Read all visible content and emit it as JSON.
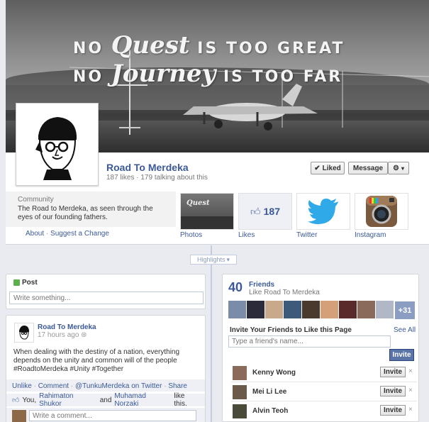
{
  "cover": {
    "line1_a": "NO",
    "line1_script": "Quest",
    "line1_b": "IS TOO GREAT",
    "line2_a": "NO",
    "line2_script": "Journey",
    "line2_b": "IS TOO FAR"
  },
  "page": {
    "name": "Road To Merdeka",
    "stats": "187 likes · 179 talking about this",
    "liked_label": "Liked",
    "message_label": "Message"
  },
  "about": {
    "category": "Community",
    "description": "The Road to Merdeka, as seen through the eyes of our founding fathers.",
    "about_link": "About",
    "separator": "·",
    "suggest_link": "Suggest a Change"
  },
  "apps": {
    "photos": "Photos",
    "likes": "Likes",
    "likes_count": "187",
    "twitter": "Twitter",
    "instagram": "Instagram",
    "photos_thumb_text": "Quest"
  },
  "highlights_label": "Highlights",
  "composer": {
    "label": "Post",
    "placeholder": "Write something..."
  },
  "post": {
    "author": "Road To Merdeka",
    "time": "17 hours ago",
    "text": "When dealing with the destiny of a nation, everything depends on the unity and common will of the people #RoadtoMerdeka #Unity #Together",
    "unlike": "Unlike",
    "comment": "Comment",
    "twitter": "@TunkuMerdeka on Twitter",
    "share": "Share",
    "dot": "·",
    "likes_prefix": "You,",
    "liker1": "Rahimaton Shukor",
    "and": "and",
    "liker2": "Muhamad Norzaki",
    "likes_suffix": "like this.",
    "comment_placeholder": "Write a comment..."
  },
  "friends": {
    "count": "40",
    "title": "Friends",
    "subtitle": "Like Road To Merdeka",
    "more": "+31",
    "invite_title": "Invite Your Friends to Like this Page",
    "see_all": "See All",
    "input_placeholder": "Type a friend's name...",
    "invite_label": "Invite",
    "rows": [
      {
        "name": "Kenny Wong",
        "button": "Invite",
        "x": "×"
      },
      {
        "name": "Mei Li Lee",
        "button": "Invite",
        "x": "×"
      },
      {
        "name": "Alvin Teoh",
        "button": "Invite",
        "x": "×"
      }
    ]
  },
  "colors": {
    "brand": "#3b5998",
    "timeline_bg": "#e9ebf1",
    "invite_button": "#5b74a8",
    "twitter_blue": "#2fa9e8"
  }
}
